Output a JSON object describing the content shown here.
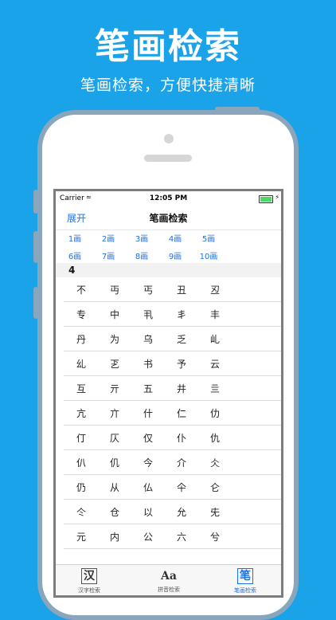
{
  "promo": {
    "title": "笔画检索",
    "subtitle": "笔画检索，方便快捷清晰"
  },
  "status_bar": {
    "carrier": "Carrier",
    "time": "12:05 PM"
  },
  "nav": {
    "left": "展开",
    "title": "笔画检索"
  },
  "stroke_buttons": [
    [
      "1画",
      "2画",
      "3画",
      "4画",
      "5画"
    ],
    [
      "6画",
      "7画",
      "8画",
      "9画",
      "10画"
    ]
  ],
  "section": "4",
  "chars": [
    [
      "不",
      "丏",
      "丐",
      "丑",
      "丒"
    ],
    [
      "专",
      "中",
      "丮",
      "丯",
      "丰"
    ],
    [
      "丹",
      "为",
      "乌",
      "乏",
      "乢"
    ],
    [
      "乣",
      "乤",
      "书",
      "予",
      "云"
    ],
    [
      "互",
      "亓",
      "五",
      "井",
      "亖"
    ],
    [
      "亢",
      "亣",
      "什",
      "仁",
      "仂"
    ],
    [
      "仃",
      "仄",
      "仅",
      "仆",
      "仇"
    ],
    [
      "仈",
      "仉",
      "今",
      "介",
      "仌"
    ],
    [
      "仍",
      "从",
      "仏",
      "仐",
      "仑"
    ],
    [
      "仒",
      "仓",
      "以",
      "允",
      "兂"
    ],
    [
      "元",
      "内",
      "公",
      "六",
      "兮"
    ]
  ],
  "tabs": [
    {
      "icon": "汉",
      "label": "汉字检索"
    },
    {
      "icon": "Aa",
      "label": "拼音检索"
    },
    {
      "icon": "笔",
      "label": "笔画检索"
    }
  ],
  "colors": {
    "background": "#1aa3e8",
    "accent": "#1a73e8",
    "phone_frame": "#8aa6bc"
  }
}
